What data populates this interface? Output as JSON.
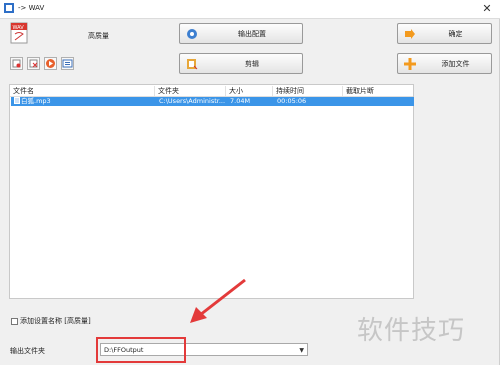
{
  "window": {
    "title": "-> WAV",
    "close": "✕"
  },
  "profile": {
    "quality_label": "高质量"
  },
  "buttons": {
    "output_settings": "输出配置",
    "confirm": "确定",
    "clip": "剪辑",
    "add_file": "添加文件"
  },
  "table": {
    "columns": [
      "文件名",
      "文件夹",
      "大小",
      "持续时间",
      "截取片断"
    ],
    "rows": [
      {
        "name": "白狐.mp3",
        "folder": "C:\\Users\\Administr...",
        "size": "7.04M",
        "duration": "00:05:06",
        "clip": ""
      }
    ]
  },
  "bottom": {
    "add_setting_name": "添加设置名称 [高质量]",
    "output_folder_label": "输出文件夹",
    "output_folder_value": "D:\\FFOutput"
  },
  "watermark": "软件技巧",
  "colors": {
    "selection": "#3b95e8",
    "annotation": "#e33a3a",
    "add_icon": "#f39a1e"
  }
}
